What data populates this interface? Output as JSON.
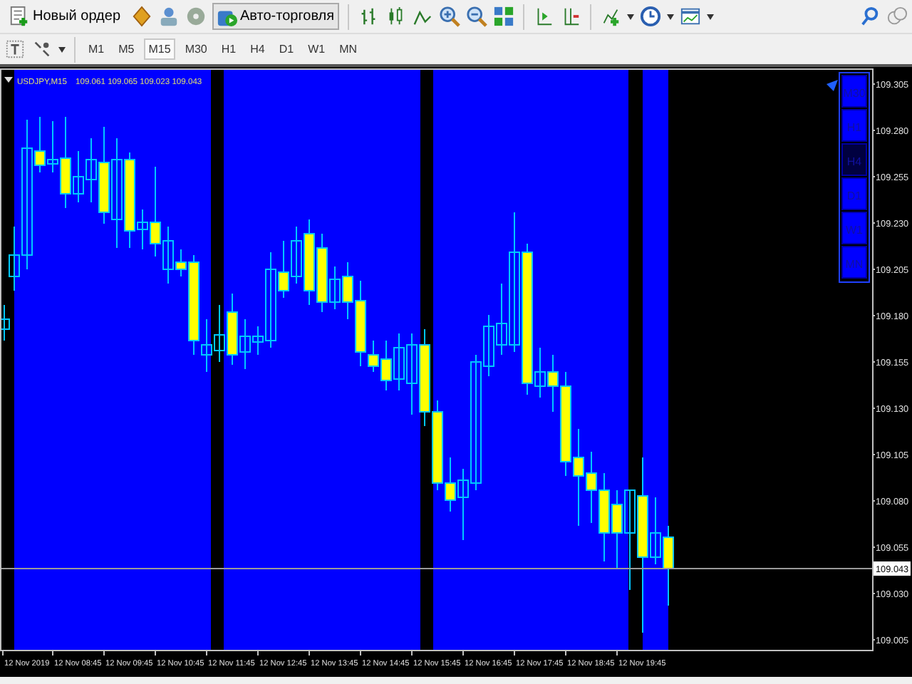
{
  "toolbar": {
    "new_order": "Новый ордер",
    "auto_trading": "Авто-торговля"
  },
  "periods": [
    {
      "label": "M1",
      "selected": false
    },
    {
      "label": "M5",
      "selected": false
    },
    {
      "label": "M15",
      "selected": true
    },
    {
      "label": "M30",
      "selected": false
    },
    {
      "label": "H1",
      "selected": false
    },
    {
      "label": "H4",
      "selected": false
    },
    {
      "label": "D1",
      "selected": false
    },
    {
      "label": "W1",
      "selected": false
    },
    {
      "label": "MN",
      "selected": false
    }
  ],
  "chart": {
    "symbol": "USDJPY,M15",
    "quote": "109.061 109.065 109.023 109.043",
    "period_buttons": [
      {
        "label": "M30",
        "selected": false
      },
      {
        "label": "H1",
        "selected": false
      },
      {
        "label": "H4",
        "selected": true
      },
      {
        "label": "D1",
        "selected": false
      },
      {
        "label": "W1",
        "selected": false
      },
      {
        "label": "MN",
        "selected": false
      }
    ],
    "price_labels": [
      "109.305",
      "109.280",
      "109.255",
      "109.230",
      "109.205",
      "109.180",
      "109.155",
      "109.130",
      "109.105",
      "109.080",
      "109.055",
      "109.030",
      "109.005"
    ],
    "current_price": "109.043",
    "time_labels": [
      "12 Nov 2019",
      "12 Nov 08:45",
      "12 Nov 09:45",
      "12 Nov 10:45",
      "12 Nov 11:45",
      "12 Nov 12:45",
      "12 Nov 13:45",
      "12 Nov 14:45",
      "12 Nov 15:45",
      "12 Nov 16:45",
      "12 Nov 17:45",
      "12 Nov 18:45",
      "12 Nov 19:45"
    ]
  }
}
